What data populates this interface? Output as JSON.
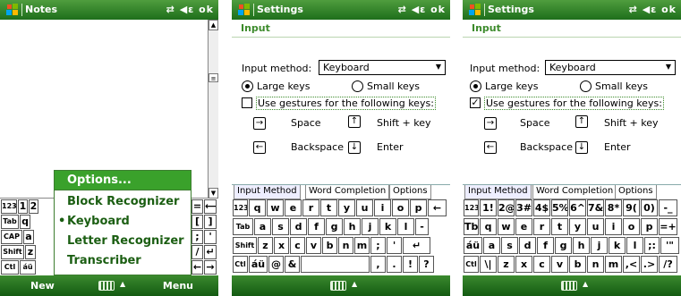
{
  "screens": [
    {
      "title": "Notes",
      "status": "⇄ ◀ε ok",
      "softkeys": {
        "left": "New",
        "right": "Menu"
      },
      "menu": {
        "items": [
          {
            "label": "Options...",
            "selected": true
          },
          {
            "label": "Block Recognizer",
            "selected": false
          },
          {
            "label": "Keyboard",
            "selected": false,
            "checked": true
          },
          {
            "label": "Letter Recognizer",
            "selected": false
          },
          {
            "label": "Transcriber",
            "selected": false
          }
        ]
      },
      "keyboard_visible": [
        "123",
        "1",
        "2",
        "Tab",
        "q",
        "CAP",
        "a",
        "Shift",
        "z",
        "Ctl",
        "áü",
        "=",
        "⟵",
        "p",
        "[",
        "]",
        ";",
        "'",
        "/",
        "↵",
        "←",
        "→"
      ]
    },
    {
      "title": "Settings",
      "status": "⇄ ◀ε ok",
      "header": "Input",
      "input_method_label": "Input method:",
      "input_method_value": "Keyboard",
      "large_keys": "Large keys",
      "small_keys": "Small keys",
      "gestures_label": "Use gestures for the following keys:",
      "gestures_checked": false,
      "space": "Space",
      "shift_key": "Shift + key",
      "backspace": "Backspace",
      "enter": "Enter",
      "tabs": [
        "Input Method",
        "Word Completion",
        "Options"
      ],
      "rows": [
        [
          "123",
          "q",
          "w",
          "e",
          "r",
          "t",
          "y",
          "u",
          "i",
          "o",
          "p",
          "←"
        ],
        [
          "Tab",
          "a",
          "s",
          "d",
          "f",
          "g",
          "h",
          "j",
          "k",
          "l",
          "-"
        ],
        [
          "Shift",
          "z",
          "x",
          "c",
          "v",
          "b",
          "n",
          "m",
          ";",
          "'",
          "↵"
        ],
        [
          "Ctl",
          "áü",
          "@",
          "&",
          "",
          ",",
          ".",
          "!",
          "?"
        ]
      ]
    },
    {
      "title": "Settings",
      "status": "⇄ ◀ε ok",
      "header": "Input",
      "input_method_label": "Input method:",
      "input_method_value": "Keyboard",
      "large_keys": "Large keys",
      "small_keys": "Small keys",
      "gestures_label": "Use gestures for the following keys:",
      "gestures_checked": true,
      "space": "Space",
      "shift_key": "Shift + key",
      "backspace": "Backspace",
      "enter": "Enter",
      "tabs": [
        "Input Method",
        "Word Completion",
        "Options"
      ],
      "rows": [
        [
          "123",
          "1!",
          "2@",
          "3#",
          "4$",
          "5%",
          "6^",
          "7&",
          "8*",
          "9(",
          "0)",
          "-_"
        ],
        [
          "Tb",
          "q",
          "w",
          "e",
          "r",
          "t",
          "y",
          "u",
          "i",
          "o",
          "p",
          "=+"
        ],
        [
          "áü",
          "a",
          "s",
          "d",
          "f",
          "g",
          "h",
          "j",
          "k",
          "l",
          ";:",
          "'\""
        ],
        [
          "Ctl",
          "\\|",
          "z",
          "x",
          "c",
          "v",
          "b",
          "n",
          "m",
          ",<",
          ".>",
          "/?"
        ]
      ]
    }
  ],
  "colors": {
    "title_bar": "#2f7f26",
    "accent": "#3d8b2c",
    "menu_sel": "#3aa12b"
  }
}
